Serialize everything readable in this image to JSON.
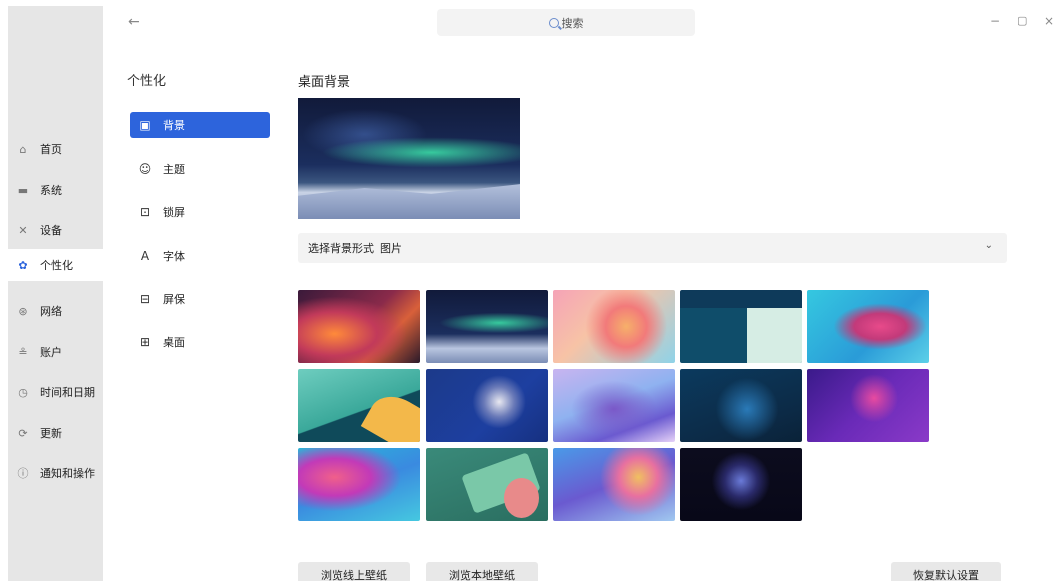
{
  "search": {
    "text": "搜索"
  },
  "sidebar": {
    "items": [
      {
        "label": "首页",
        "icon": "home-icon",
        "glyph": "⌂"
      },
      {
        "label": "系统",
        "icon": "display-icon",
        "glyph": "▬"
      },
      {
        "label": "设备",
        "icon": "tools-icon",
        "glyph": "✕"
      },
      {
        "label": "个性化",
        "icon": "palette-icon",
        "glyph": "✿"
      },
      {
        "label": "网络",
        "icon": "network-icon",
        "glyph": "⊛"
      },
      {
        "label": "账户",
        "icon": "user-icon",
        "glyph": "≗"
      },
      {
        "label": "时间和日期",
        "icon": "clock-icon",
        "glyph": "◷"
      },
      {
        "label": "更新",
        "icon": "update-icon",
        "glyph": "⟳"
      },
      {
        "label": "通知和操作",
        "icon": "info-icon",
        "glyph": "ⓘ"
      }
    ]
  },
  "submenu": {
    "title": "个性化",
    "items": [
      {
        "label": "背景",
        "icon": "image-icon",
        "glyph": "▣"
      },
      {
        "label": "主题",
        "icon": "theme-icon",
        "glyph": "☺"
      },
      {
        "label": "锁屏",
        "icon": "lock-screen-icon",
        "glyph": "⊡"
      },
      {
        "label": "字体",
        "icon": "font-icon",
        "glyph": "A"
      },
      {
        "label": "屏保",
        "icon": "screensaver-icon",
        "glyph": "⊟"
      },
      {
        "label": "桌面",
        "icon": "desktop-icon",
        "glyph": "⊞"
      }
    ]
  },
  "main": {
    "title": "桌面背景",
    "select_label": "选择背景形式",
    "select_value": "图片"
  },
  "buttons": {
    "browse_online": "浏览线上壁纸",
    "browse_local": "浏览本地壁纸",
    "restore_default": "恢复默认设置"
  },
  "colors": {
    "accent": "#2d64dc"
  }
}
